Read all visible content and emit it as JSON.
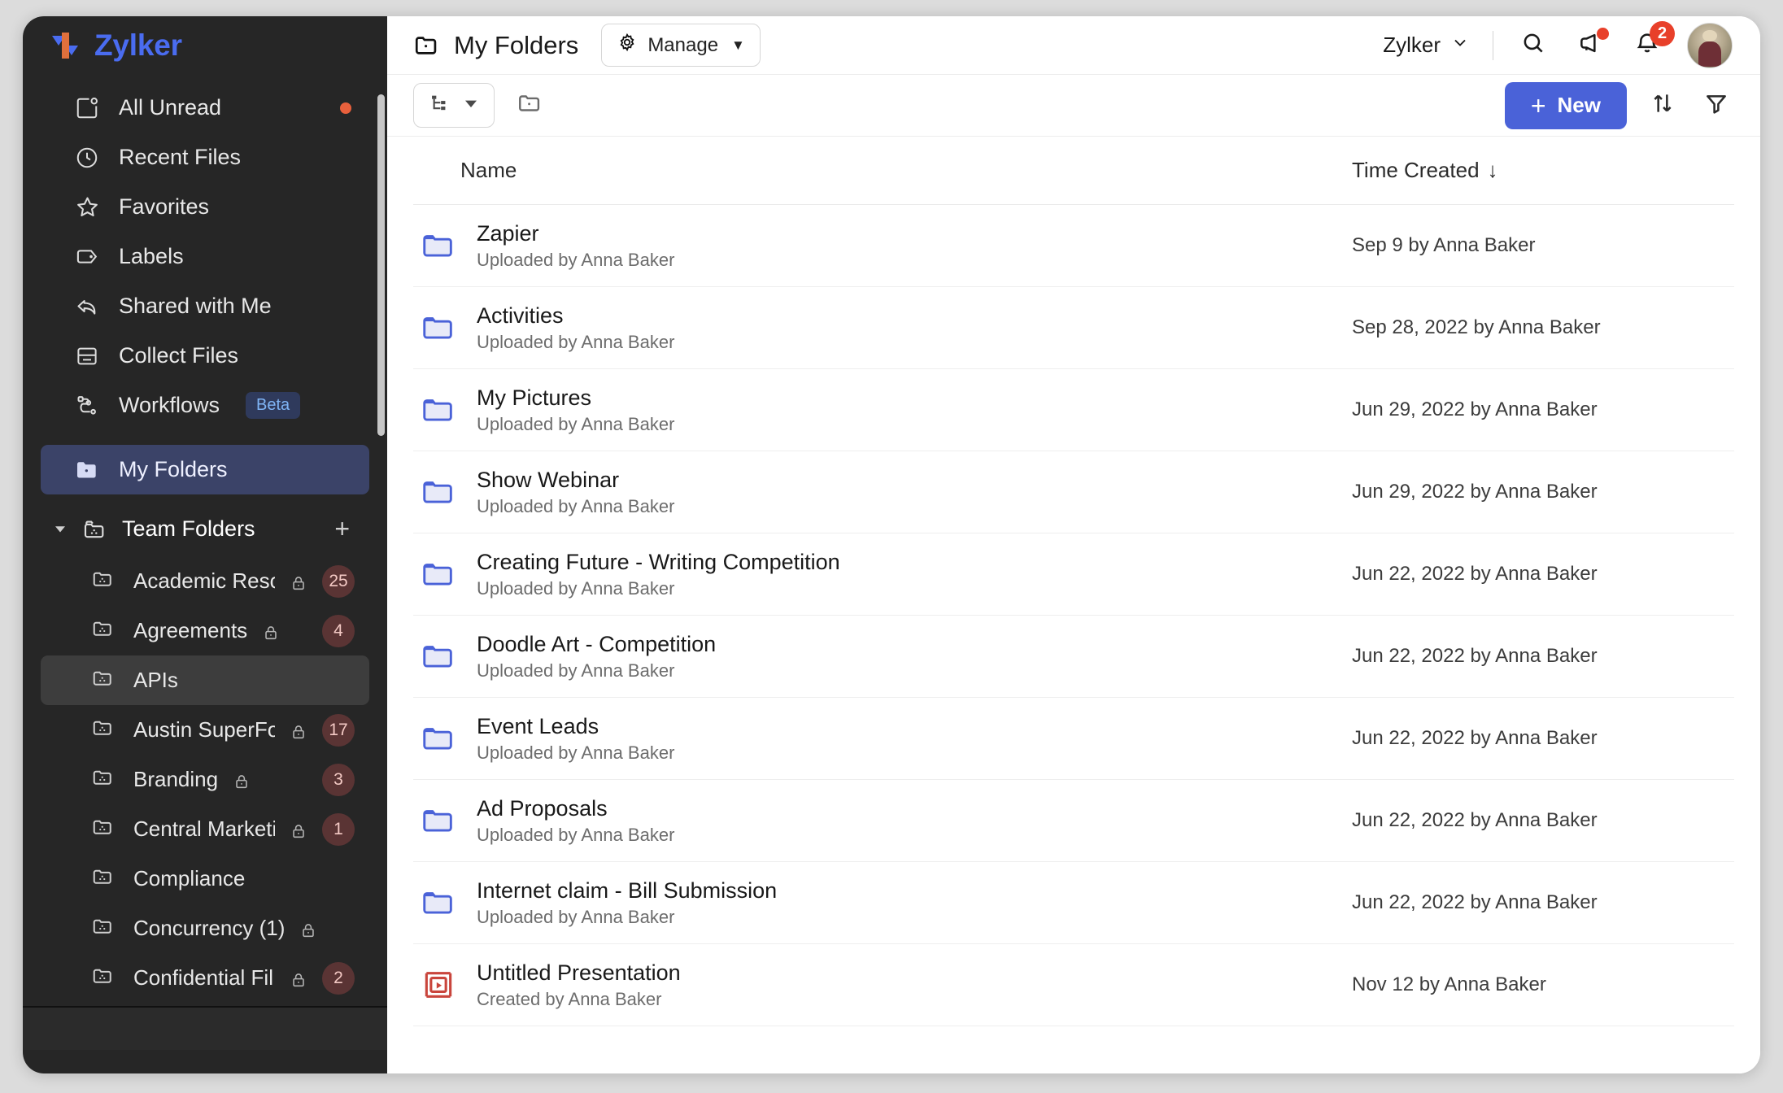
{
  "brand": {
    "name": "Zylker"
  },
  "sidebar": {
    "nav": [
      {
        "label": "All Unread",
        "icon": "unread-document-icon",
        "dot": true
      },
      {
        "label": "Recent Files",
        "icon": "clock-icon",
        "dot": false
      },
      {
        "label": "Favorites",
        "icon": "star-icon",
        "dot": false
      },
      {
        "label": "Labels",
        "icon": "tag-icon",
        "dot": false
      },
      {
        "label": "Shared with Me",
        "icon": "share-arrow-icon",
        "dot": false
      },
      {
        "label": "Collect Files",
        "icon": "inbox-icon",
        "dot": false
      },
      {
        "label": "Workflows",
        "icon": "workflow-icon",
        "dot": false,
        "badge": "Beta"
      }
    ],
    "my_folders": {
      "label": "My Folders",
      "icon": "folder-icon"
    },
    "team_folders": {
      "label": "Team Folders",
      "icon": "team-folder-icon",
      "add_label": "+",
      "items": [
        {
          "label": "Academic Reso...",
          "locked": true,
          "count": "25",
          "active": false
        },
        {
          "label": "Agreements",
          "locked": true,
          "count": "4",
          "active": false
        },
        {
          "label": "APIs",
          "locked": false,
          "count": "",
          "active": true
        },
        {
          "label": "Austin SuperFo...",
          "locked": true,
          "count": "17",
          "active": false
        },
        {
          "label": "Branding",
          "locked": true,
          "count": "3",
          "active": false
        },
        {
          "label": "Central Marketi...",
          "locked": true,
          "count": "1",
          "active": false
        },
        {
          "label": "Compliance",
          "locked": false,
          "count": "",
          "active": false
        },
        {
          "label": "Concurrency (1)",
          "locked": true,
          "count": "",
          "active": false
        },
        {
          "label": "Confidential Fil...",
          "locked": true,
          "count": "2",
          "active": false
        }
      ]
    }
  },
  "topbar": {
    "title": "My Folders",
    "folder_icon": "folder-icon",
    "manage_label": "Manage",
    "manage_icon": "gear-icon",
    "org_name": "Zylker",
    "search_icon": "search-icon",
    "announce_icon": "megaphone-icon",
    "bell_icon": "bell-icon",
    "bell_count": "2",
    "avatar": "user-avatar"
  },
  "actionbar": {
    "view_icon": "tree-view-icon",
    "breadcrumb_icon": "folder-outline-icon",
    "new_label": "New",
    "sort_icon": "sort-icon",
    "filter_icon": "filter-icon"
  },
  "table": {
    "columns": {
      "name": "Name",
      "time": "Time Created",
      "sort_arrow": "↓"
    },
    "rows": [
      {
        "title": "Zapier",
        "sub": "Uploaded by Anna Baker",
        "time": "Sep 9 by Anna Baker",
        "icon": "folder-icon"
      },
      {
        "title": "Activities",
        "sub": "Uploaded by Anna Baker",
        "time": "Sep 28, 2022 by Anna Baker",
        "icon": "folder-icon"
      },
      {
        "title": "My Pictures",
        "sub": "Uploaded by Anna Baker",
        "time": "Jun 29, 2022 by Anna Baker",
        "icon": "folder-icon"
      },
      {
        "title": "Show Webinar",
        "sub": "Uploaded by Anna Baker",
        "time": "Jun 29, 2022 by Anna Baker",
        "icon": "folder-icon"
      },
      {
        "title": "Creating Future - Writing Competition",
        "sub": "Uploaded by Anna Baker",
        "time": "Jun 22, 2022 by Anna Baker",
        "icon": "folder-icon"
      },
      {
        "title": "Doodle Art - Competition",
        "sub": "Uploaded by Anna Baker",
        "time": "Jun 22, 2022 by Anna Baker",
        "icon": "folder-icon"
      },
      {
        "title": "Event Leads",
        "sub": "Uploaded by Anna Baker",
        "time": "Jun 22, 2022 by Anna Baker",
        "icon": "folder-icon"
      },
      {
        "title": "Ad Proposals",
        "sub": "Uploaded by Anna Baker",
        "time": "Jun 22, 2022 by Anna Baker",
        "icon": "folder-icon"
      },
      {
        "title": "Internet claim - Bill Submission",
        "sub": "Uploaded by Anna Baker",
        "time": "Jun 22, 2022 by Anna Baker",
        "icon": "folder-icon"
      },
      {
        "title": "Untitled Presentation",
        "sub": "Created by Anna Baker",
        "time": "Nov 12 by Anna Baker",
        "icon": "presentation-icon"
      }
    ]
  },
  "colors": {
    "accent_blue": "#4a62d8",
    "brand_blue": "#4a6cf0",
    "brand_orange": "#e0703c",
    "sidebar_bg": "#262626",
    "selected_nav": "#3b4368",
    "badge_red": "#e8402a",
    "count_badge_bg": "#5a3434",
    "presentation_red": "#c9453c"
  }
}
